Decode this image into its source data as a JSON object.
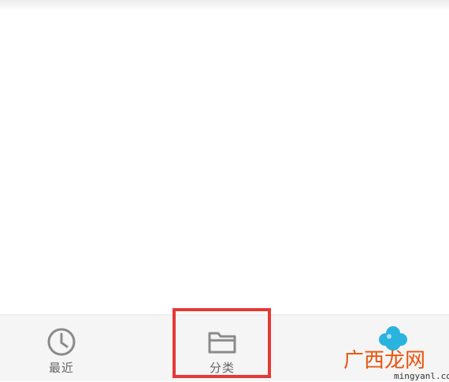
{
  "nav": {
    "items": [
      {
        "label": "最近",
        "icon": "clock-icon"
      },
      {
        "label": "分类",
        "icon": "folder-icon"
      }
    ]
  },
  "watermark": {
    "title": "广西龙网",
    "url": "mingyanl.com",
    "icon": "cloud-logo-icon"
  },
  "colors": {
    "highlight": "#e53935",
    "nav_background": "#f5f5f5",
    "icon_stroke": "#8a8a8a",
    "watermark_title": "#e8540c",
    "watermark_cloud": "#2bb3e0"
  }
}
